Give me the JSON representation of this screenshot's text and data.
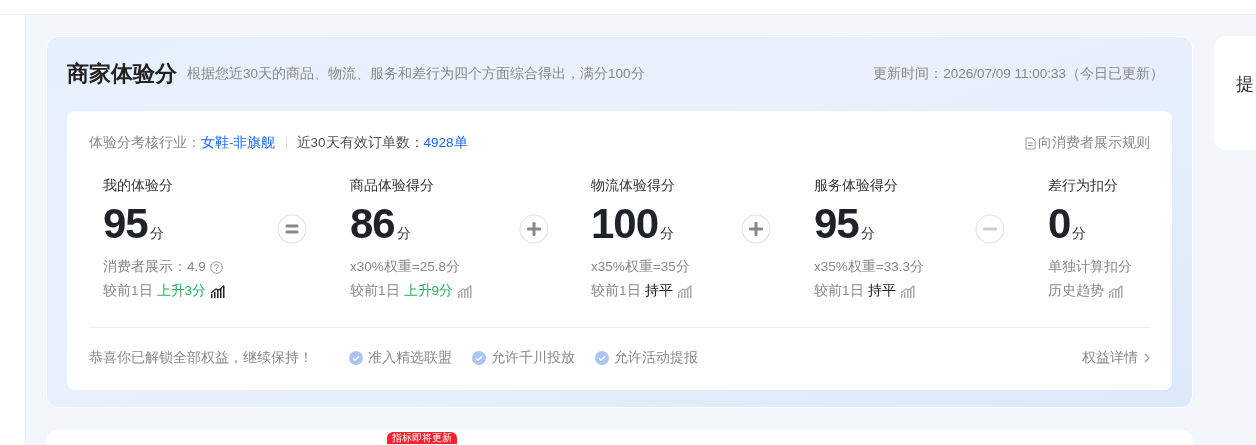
{
  "header": {
    "title": "商家体验分",
    "subtitle": "根据您近30天的商品、物流、服务和差行为四个方面综合得出，满分100分",
    "update_time": "更新时间：2026/07/09 11:00:33（今日已更新）"
  },
  "info_bar": {
    "industry_label": "体验分考核行业：",
    "industry_value": "女鞋-非旗舰",
    "orders_label": "近30天有效订单数：",
    "orders_value": "4928单",
    "rules_link": "向消费者展示规则"
  },
  "metrics": [
    {
      "label": "我的体验分",
      "value": "95",
      "unit": "分",
      "detail": {
        "kind": "consumer",
        "text": "消费者展示：4.9"
      },
      "compare_label": "较前1日",
      "trend": {
        "kind": "up",
        "text": "上升3分"
      },
      "trend_icon_active": true,
      "operator": {
        "kind": "equals"
      }
    },
    {
      "label": "商品体验得分",
      "value": "86",
      "unit": "分",
      "detail": {
        "kind": "plain",
        "text": "x30%权重=25.8分"
      },
      "compare_label": "较前1日",
      "trend": {
        "kind": "up",
        "text": "上升9分"
      },
      "trend_icon_active": false,
      "operator": {
        "kind": "plus"
      }
    },
    {
      "label": "物流体验得分",
      "value": "100",
      "unit": "分",
      "detail": {
        "kind": "plain",
        "text": "x35%权重=35分"
      },
      "compare_label": "较前1日",
      "trend": {
        "kind": "flat",
        "text": "持平"
      },
      "trend_icon_active": false,
      "operator": {
        "kind": "plus"
      }
    },
    {
      "label": "服务体验得分",
      "value": "95",
      "unit": "分",
      "detail": {
        "kind": "plain",
        "text": "x35%权重=33.3分"
      },
      "compare_label": "较前1日",
      "trend": {
        "kind": "flat",
        "text": "持平"
      },
      "trend_icon_active": false,
      "operator": {
        "kind": "minus"
      }
    },
    {
      "label": "差行为扣分",
      "value": "0",
      "unit": "分",
      "detail": {
        "kind": "plain",
        "text": "单独计算扣分"
      },
      "compare_label": "历史趋势",
      "trend_icon_active": false
    }
  ],
  "footer": {
    "message": "恭喜你已解锁全部权益，继续保持！",
    "benefits": [
      "准入精选联盟",
      "允许千川投放",
      "允许活动提报"
    ],
    "details_link": "权益详情"
  },
  "side_card": {
    "text": "提"
  },
  "next_card": {
    "badge": "指标即将更新"
  }
}
